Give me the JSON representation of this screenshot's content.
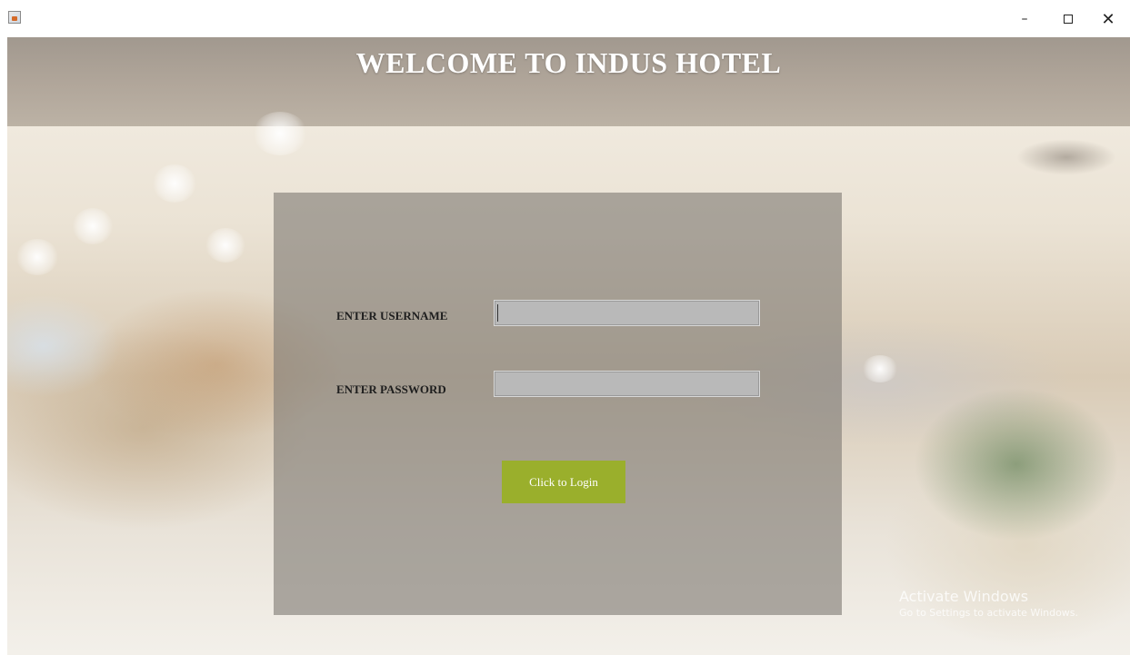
{
  "window": {
    "app_icon": "java-app-icon",
    "controls": {
      "minimize": "–",
      "maximize_icon": "maximize-icon",
      "close": "✕"
    }
  },
  "header": {
    "title": "WELCOME TO INDUS HOTEL"
  },
  "login": {
    "username_label": "ENTER USERNAME",
    "username_value": "",
    "password_label": "ENTER PASSWORD",
    "password_value": "",
    "submit_label": "Click to Login",
    "submit_color": "#9aaf2c"
  },
  "watermark": {
    "title": "Activate Windows",
    "subtitle": "Go to Settings to activate Windows."
  }
}
